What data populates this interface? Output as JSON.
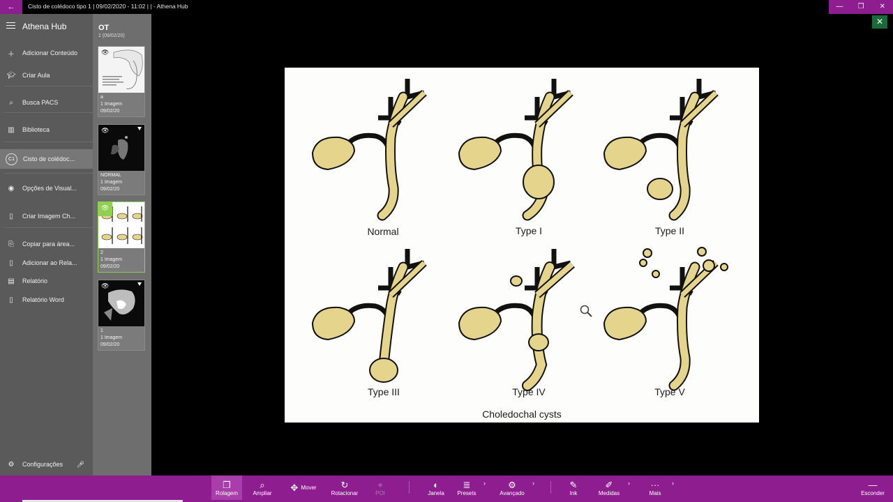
{
  "window": {
    "title": "Cisto de colédoco tipo 1 | 09/02/2020 - 11:02 |  | - Athena Hub",
    "controls": [
      "—",
      "❐",
      "✕"
    ]
  },
  "sidebar": {
    "app_title": "Athena Hub",
    "items": [
      {
        "icon": "plus-icon",
        "label": "Adicionar Conteúdo"
      },
      {
        "icon": "graduation-cap-icon",
        "label": "Criar Aula"
      },
      {
        "icon": "search-icon",
        "label": "Busca PACS"
      },
      {
        "icon": "library-icon",
        "label": "Biblioteca"
      },
      {
        "icon": "c1-badge-icon",
        "label": "Cisto de colédoc...",
        "badge": "C1"
      },
      {
        "icon": "eye-icon",
        "label": "Opções de Visual..."
      },
      {
        "icon": "image-icon",
        "label": "Criar Imagem Ch..."
      },
      {
        "icon": "copy-icon",
        "label": "Copiar para área..."
      },
      {
        "icon": "report-add-icon",
        "label": "Adicionar ao Rela..."
      },
      {
        "icon": "report-icon",
        "label": "Relatório"
      },
      {
        "icon": "word-icon",
        "label": "Relatório Word"
      }
    ],
    "settings_label": "Configurações"
  },
  "thumbnails": {
    "header": "OT",
    "subheader": "1 (09/02/20)",
    "items": [
      {
        "name": "a",
        "count": "1 Imagem",
        "date": "09/02/20"
      },
      {
        "name": "NORMAL",
        "count": "1 Imagem",
        "date": "09/02/20"
      },
      {
        "name": "2",
        "count": "1 Imagem",
        "date": "09/02/20"
      },
      {
        "name": "1",
        "count": "1 Imagem",
        "date": "09/02/20"
      }
    ]
  },
  "viewer": {
    "labels": [
      "Normal",
      "Type I",
      "Type II",
      "Type III",
      "Type IV",
      "Type V"
    ],
    "caption": "Choledochal cysts",
    "colors": {
      "duct": "#e5d48c",
      "outline": "#111111",
      "background": "#fdfdfb"
    }
  },
  "toolbar": {
    "tools": [
      {
        "label": "Rolagem",
        "icon": "layers-icon"
      },
      {
        "label": "Ampliar",
        "icon": "magnify-icon"
      },
      {
        "label": "Mover",
        "icon": "move-icon"
      },
      {
        "label": "Rotacionar",
        "icon": "rotate-icon"
      },
      {
        "label": "POI",
        "icon": "poi-icon"
      },
      {
        "label": "Janela",
        "icon": "contrast-icon"
      },
      {
        "label": "Presets",
        "icon": "list-icon"
      },
      {
        "label": "Avançado",
        "icon": "gear-icon"
      },
      {
        "label": "Ink",
        "icon": "pen-icon"
      },
      {
        "label": "Medidas",
        "icon": "ruler-icon"
      },
      {
        "label": "Mais",
        "icon": "more-icon"
      }
    ],
    "hide_label": "Esconder",
    "accent": "#8e1d8f"
  }
}
